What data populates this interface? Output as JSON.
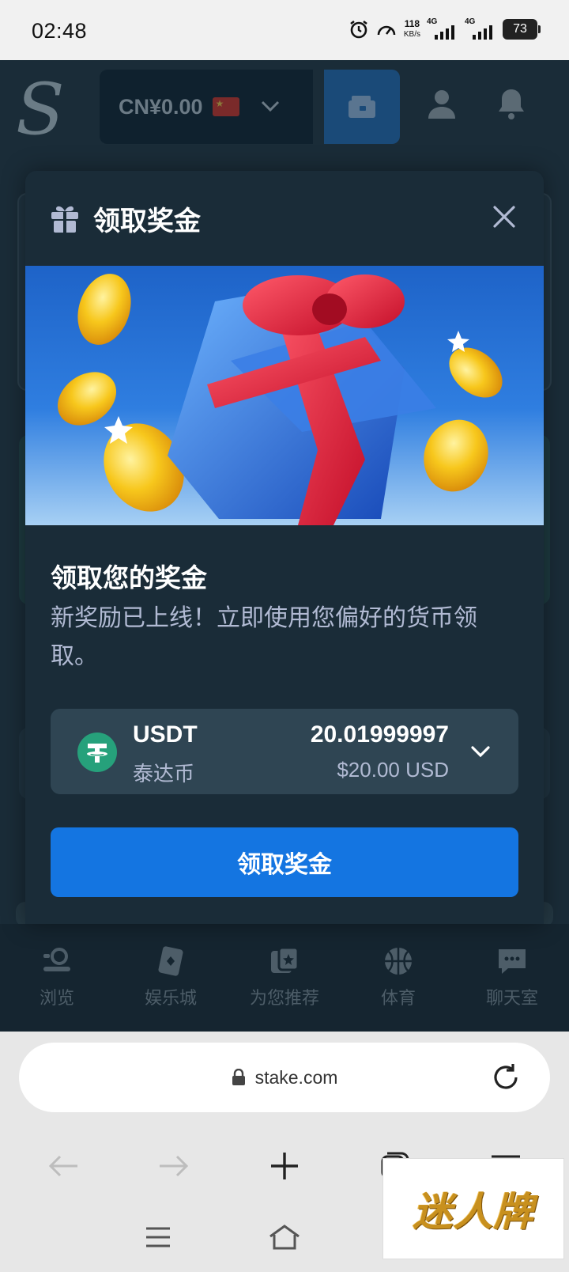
{
  "status_bar": {
    "time": "02:48",
    "net_speed_value": "118",
    "net_speed_unit": "KB/s",
    "sim1": "4G",
    "sim2": "4G",
    "battery": "73",
    "icons": [
      "alarm-icon",
      "speedometer-icon",
      "signal-icon",
      "battery-icon"
    ]
  },
  "site_header": {
    "logo": "S",
    "balance": "CN¥0.00",
    "icons": [
      "flag-icon",
      "chevron-down-icon",
      "wallet-icon",
      "user-icon",
      "bell-icon"
    ]
  },
  "modal": {
    "header_title": "领取奖金",
    "title": "领取您的奖金",
    "description": "新奖励已上线！立即使用您偏好的货币领取。",
    "currency": {
      "code": "USDT",
      "name": "泰达币",
      "amount": "20.01999997",
      "usd_value": "$20.00 USD"
    },
    "claim_button": "领取奖金",
    "icons": [
      "gift-icon",
      "close-icon",
      "tether-icon",
      "chevron-down-icon"
    ]
  },
  "site_nav": {
    "items": [
      {
        "label": "浏览",
        "icon": "browse-icon"
      },
      {
        "label": "娱乐城",
        "icon": "cards-icon"
      },
      {
        "label": "为您推荐",
        "icon": "recommend-icon"
      },
      {
        "label": "体育",
        "icon": "basketball-icon"
      },
      {
        "label": "聊天室",
        "icon": "chat-icon"
      }
    ]
  },
  "browser": {
    "url": "stake.com",
    "icons": [
      "lock-icon",
      "reload-icon",
      "back-icon",
      "forward-icon",
      "plus-icon",
      "tabs-icon",
      "menu-icon",
      "home-icon"
    ]
  },
  "watermark": {
    "text": "迷人牌"
  },
  "colors": {
    "accent": "#1475e1",
    "modal_bg": "#1a2c38",
    "select_bg": "#2f4553",
    "tether": "#26a17b"
  }
}
